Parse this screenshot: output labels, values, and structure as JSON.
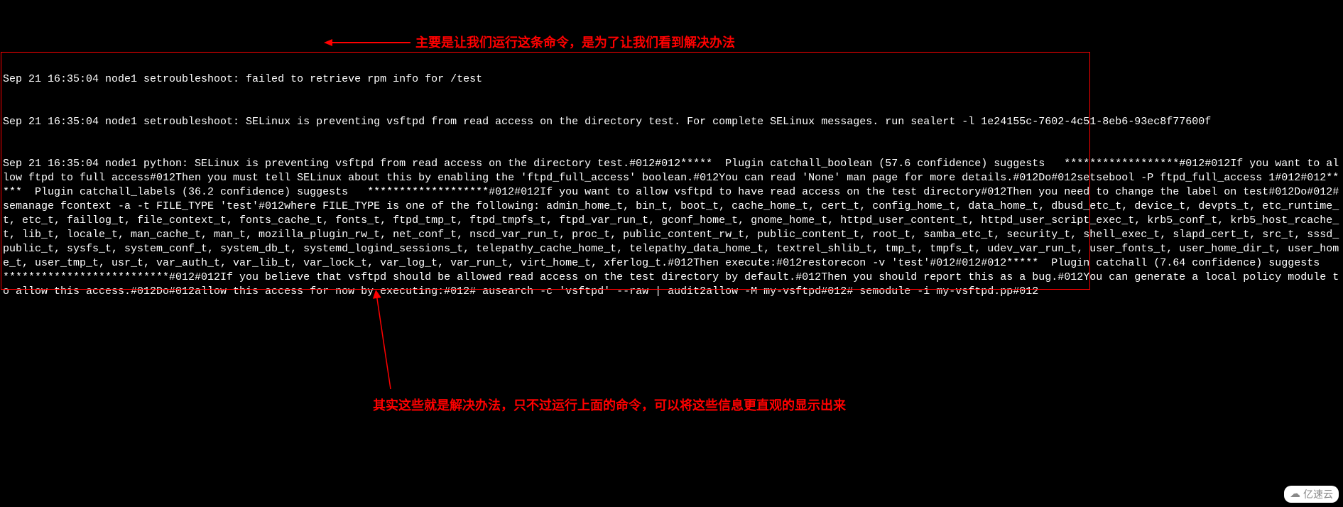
{
  "terminal": {
    "line1": "Sep 21 16:35:04 node1 setroubleshoot: failed to retrieve rpm info for /test",
    "line2": "Sep 21 16:35:04 node1 setroubleshoot: SELinux is preventing vsftpd from read access on the directory test. For complete SELinux messages. run sealert -l 1e24155c-7602-4c51-8eb6-93ec8f77600f",
    "line3": "Sep 21 16:35:04 node1 python: SELinux is preventing vsftpd from read access on the directory test.#012#012*****  Plugin catchall_boolean (57.6 confidence) suggests   ******************#012#012If you want to allow ftpd to full access#012Then you must tell SELinux about this by enabling the 'ftpd_full_access' boolean.#012You can read 'None' man page for more details.#012Do#012setsebool -P ftpd_full_access 1#012#012*****  Plugin catchall_labels (36.2 confidence) suggests   *******************#012#012If you want to allow vsftpd to have read access on the test directory#012Then you need to change the label on test#012Do#012# semanage fcontext -a -t FILE_TYPE 'test'#012where FILE_TYPE is one of the following: admin_home_t, bin_t, boot_t, cache_home_t, cert_t, config_home_t, data_home_t, dbusd_etc_t, device_t, devpts_t, etc_runtime_t, etc_t, faillog_t, file_context_t, fonts_cache_t, fonts_t, ftpd_tmp_t, ftpd_tmpfs_t, ftpd_var_run_t, gconf_home_t, gnome_home_t, httpd_user_content_t, httpd_user_script_exec_t, krb5_conf_t, krb5_host_rcache_t, lib_t, locale_t, man_cache_t, man_t, mozilla_plugin_rw_t, net_conf_t, nscd_var_run_t, proc_t, public_content_rw_t, public_content_t, root_t, samba_etc_t, security_t, shell_exec_t, slapd_cert_t, src_t, sssd_public_t, sysfs_t, system_conf_t, system_db_t, systemd_logind_sessions_t, telepathy_cache_home_t, telepathy_data_home_t, textrel_shlib_t, tmp_t, tmpfs_t, udev_var_run_t, user_fonts_t, user_home_dir_t, user_home_t, user_tmp_t, usr_t, var_auth_t, var_lib_t, var_lock_t, var_log_t, var_run_t, virt_home_t, xferlog_t.#012Then execute:#012restorecon -v 'test'#012#012#012*****  Plugin catchall (7.64 confidence) suggests   **************************#012#012If you believe that vsftpd should be allowed read access on the test directory by default.#012Then you should report this as a bug.#012You can generate a local policy module to allow this access.#012Do#012allow this access for now by executing:#012# ausearch -c 'vsftpd' --raw | audit2allow -M my-vsftpd#012# semodule -i my-vsftpd.pp#012"
  },
  "annotations": {
    "note1": "主要是让我们运行这条命令，是为了让我们看到解决办法",
    "note2": "其实这些就是解决办法，只不过运行上面的命令，可以将这些信息更直观的显示出来"
  },
  "watermark": "亿速云"
}
